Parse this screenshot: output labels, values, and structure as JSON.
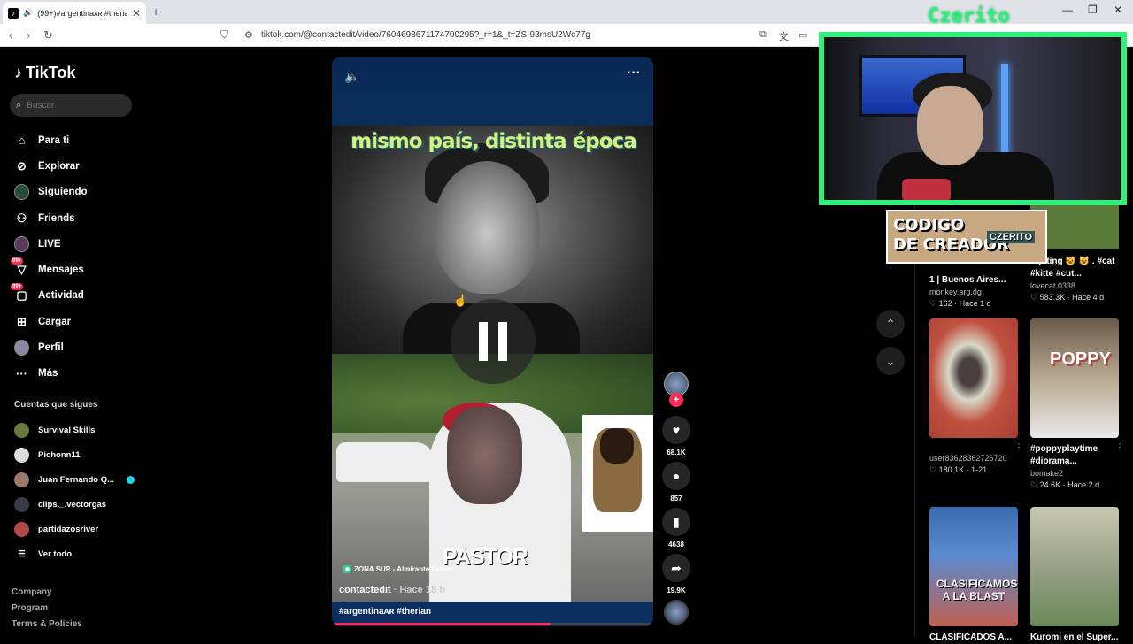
{
  "browser": {
    "tab_title": "(99+)#argentinaᴀʀ #therian |",
    "url": "tiktok.com/@contactedit/video/7604698671174700295?_r=1&_t=ZS-93msU2Wc77g",
    "new_tab": "+",
    "controls": {
      "minimize": "—",
      "maximize": "❐",
      "close": "✕"
    }
  },
  "sidebar": {
    "logo": "TikTok",
    "search_placeholder": "Buscar",
    "menu": [
      {
        "label": "Para ti",
        "icon": "home-icon"
      },
      {
        "label": "Explorar",
        "icon": "compass-icon"
      },
      {
        "label": "Siguiendo",
        "icon": "following-avatar-icon"
      },
      {
        "label": "Friends",
        "icon": "friends-icon"
      },
      {
        "label": "LIVE",
        "icon": "live-icon"
      },
      {
        "label": "Mensajes",
        "icon": "messages-icon",
        "badge": "99+"
      },
      {
        "label": "Actividad",
        "icon": "activity-icon",
        "badge": "99+"
      },
      {
        "label": "Cargar",
        "icon": "upload-icon"
      },
      {
        "label": "Perfil",
        "icon": "profile-icon"
      },
      {
        "label": "Más",
        "icon": "more-icon"
      }
    ],
    "following_title": "Cuentas que sigues",
    "following": [
      "Survival Skills",
      "Pichonn11",
      "Juan Fernando Q...",
      "clips._.vectorgas",
      "partidazosriver"
    ],
    "see_all": "Ver todo",
    "footer": [
      "Company",
      "Program",
      "Terms & Policies"
    ]
  },
  "video": {
    "caption_overlay": "mismo país, distinta época",
    "pastor_text": "PASTOR",
    "location": "ZONA SUR - Almirante Brown",
    "author": "contactedit",
    "time": "· Hace 18 h",
    "tags": "#argentinaᴀʀ #therian",
    "progress": 0.68
  },
  "actions": {
    "likes": "68.1K",
    "comments": "857",
    "saves": "4638",
    "shares": "19.9K"
  },
  "related": [
    {
      "title": "1 | Buenos Aires...",
      "user": "monkey.arg.dg",
      "stats": "♡ 162 · Hace 1 d"
    },
    {
      "title": "fighting 😺 😺 . #cat #kitte #cut...",
      "user": "lovecat.0338",
      "stats": "♡ 583.3K · Hace 4 d"
    },
    {
      "title": "",
      "user": "user83628362726720",
      "stats": "♡ 180.1K · 1-21"
    },
    {
      "title": "#poppyplaytime #diorama...",
      "user": "bomake2",
      "stats": "♡ 24.6K · Hace 2 d"
    },
    {
      "title": "CLASIFICADOS A...",
      "user": "",
      "stats": ""
    },
    {
      "title": "Kuromi en el Super...",
      "user": "",
      "stats": ""
    }
  ],
  "overlay": {
    "channel": "Czerito",
    "creator_code_line1": "CODIGO",
    "creator_code_line2": "DE CREADOR",
    "creator_name": "CZERITO",
    "thumb_text_poppy": "POPPY",
    "thumb_text_blast": "CLASIFICAMOS A LA BLAST"
  },
  "colors": {
    "accent": "#fe2c55",
    "overlay_green": "#2ef07a",
    "video_blue": "#0b2e5e"
  }
}
